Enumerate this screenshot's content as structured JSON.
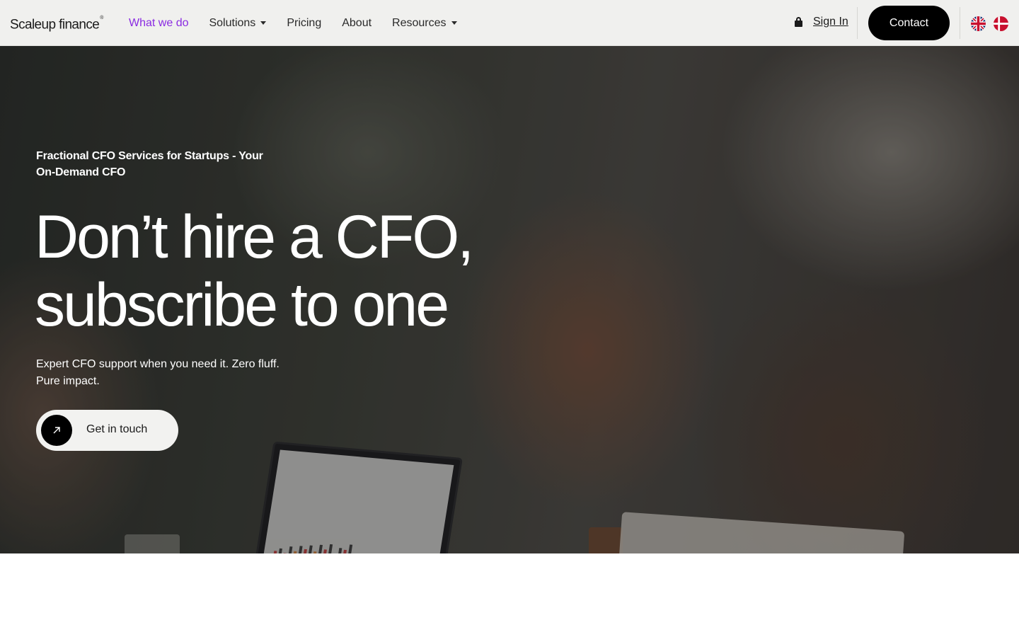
{
  "brand": {
    "name": "Scaleup finance",
    "mark": "®"
  },
  "nav": {
    "items": [
      {
        "label": "What we do",
        "active": true,
        "dropdown": false
      },
      {
        "label": "Solutions",
        "active": false,
        "dropdown": true
      },
      {
        "label": "Pricing",
        "active": false,
        "dropdown": false
      },
      {
        "label": "About",
        "active": false,
        "dropdown": false
      },
      {
        "label": "Resources",
        "active": false,
        "dropdown": true
      }
    ],
    "active_color": "#8a2be2"
  },
  "header": {
    "signin_label": "Sign In",
    "contact_label": "Contact",
    "languages": [
      "english-flag-icon",
      "danish-flag-icon"
    ]
  },
  "hero": {
    "eyebrow": "Fractional CFO Services for Startups - Your On-Demand CFO",
    "headline_line1": "Don’t hire a CFO,",
    "headline_line2": "subscribe to one",
    "sub_line1": "Expert CFO support when you need it. Zero fluff.",
    "sub_line2": "Pure impact.",
    "cta_label": "Get in touch",
    "cta_icon": "arrow-up-right-icon"
  }
}
